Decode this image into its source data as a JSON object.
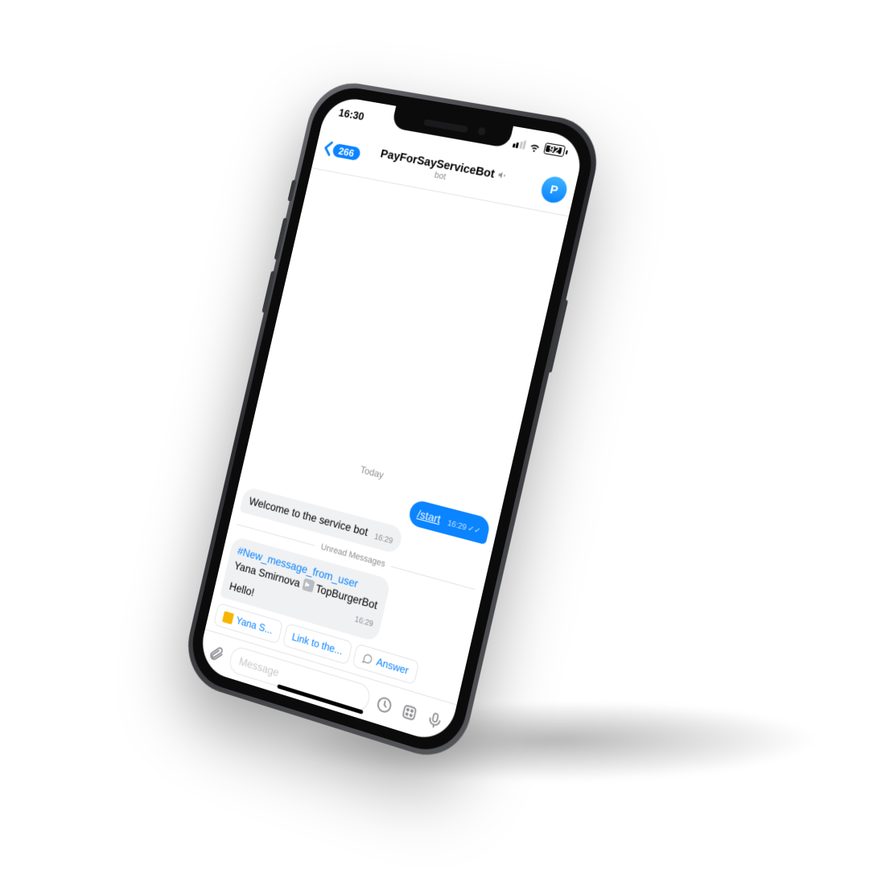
{
  "status": {
    "time": "16:30",
    "battery": "92"
  },
  "nav": {
    "back_count": "266",
    "title": "PayForSayServiceBot",
    "subtitle": "bot",
    "avatar_letter": "P"
  },
  "chat": {
    "day_label": "Today",
    "unread_label": "Unread Messages",
    "msg_start": {
      "text": "/start",
      "time": "16:29"
    },
    "msg_welcome": {
      "text": "Welcome to the service bot",
      "time": "16:29"
    },
    "msg_notice": {
      "hashtag": "#New_message_from_user",
      "line_user": "Yana Smirnova",
      "line_target": "TopBurgerBot",
      "body": "Hello!",
      "time": "16:29"
    }
  },
  "quick": {
    "btn1": "Yana S...",
    "btn2": "Link to the...",
    "btn3": "Answer"
  },
  "input": {
    "placeholder": "Message"
  }
}
